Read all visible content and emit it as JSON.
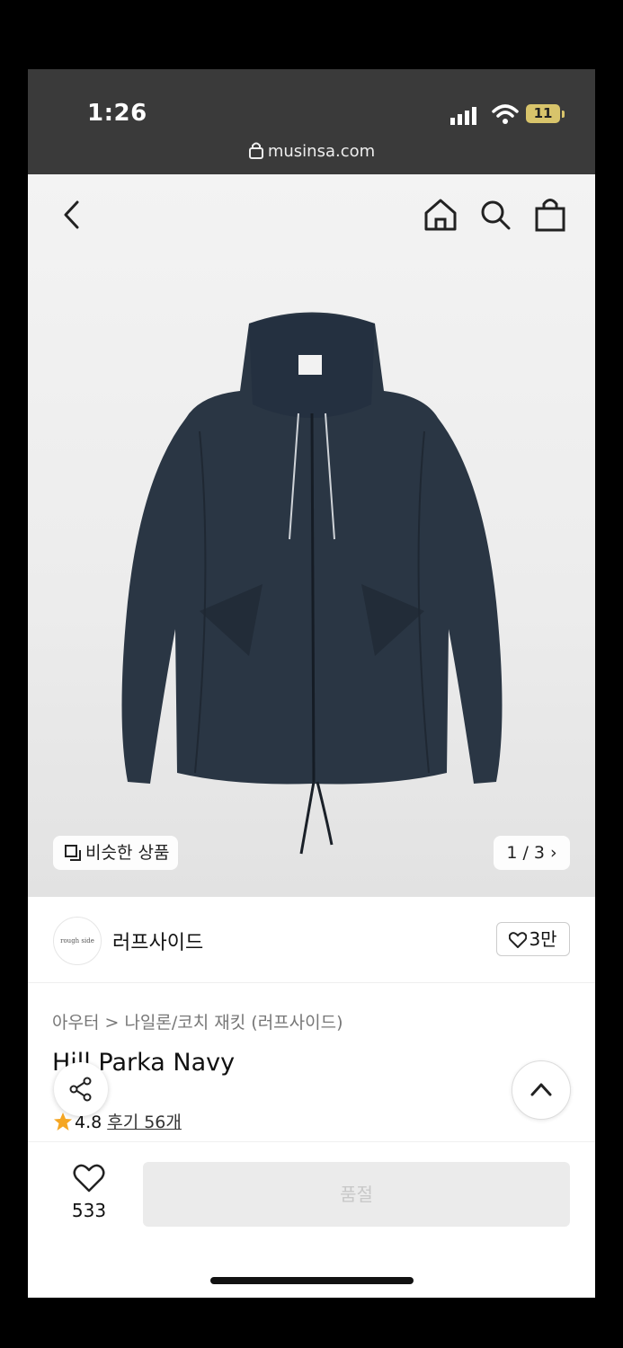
{
  "status_bar": {
    "time": "1:26",
    "battery": "11",
    "url": "musinsa.com"
  },
  "gallery": {
    "similar_label": "비슷한 상품",
    "pager": "1 / 3"
  },
  "brand": {
    "logo_text": "rough side",
    "name": "러프사이드",
    "likes": "3만"
  },
  "product": {
    "breadcrumb": "아우터 > 나일론/코치 재킷 (러프사이드)",
    "title": "Hill Parka Navy",
    "rating": "4.8",
    "reviews": "후기 56개"
  },
  "bottom": {
    "wish_count": "533",
    "buy_label": "품절"
  },
  "colors": {
    "accent_star": "#f5a623",
    "status_bg": "#3a3a3a",
    "soldout_bg": "#ebebeb"
  }
}
